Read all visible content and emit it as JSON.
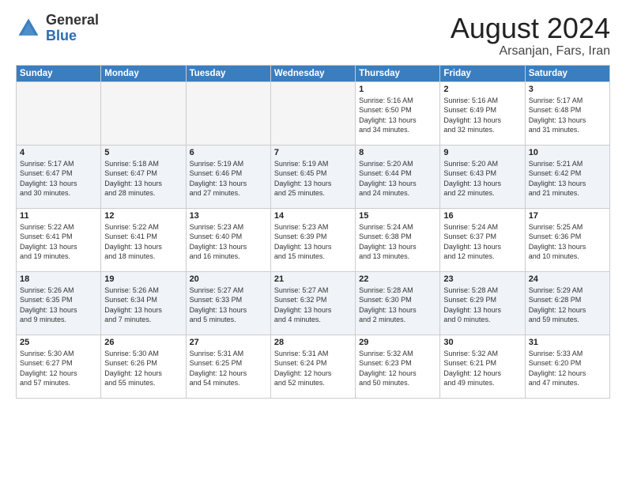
{
  "header": {
    "logo_general": "General",
    "logo_blue": "Blue",
    "month_title": "August 2024",
    "location": "Arsanjan, Fars, Iran"
  },
  "days_of_week": [
    "Sunday",
    "Monday",
    "Tuesday",
    "Wednesday",
    "Thursday",
    "Friday",
    "Saturday"
  ],
  "weeks": [
    [
      {
        "day": "",
        "info": ""
      },
      {
        "day": "",
        "info": ""
      },
      {
        "day": "",
        "info": ""
      },
      {
        "day": "",
        "info": ""
      },
      {
        "day": "1",
        "info": "Sunrise: 5:16 AM\nSunset: 6:50 PM\nDaylight: 13 hours\nand 34 minutes."
      },
      {
        "day": "2",
        "info": "Sunrise: 5:16 AM\nSunset: 6:49 PM\nDaylight: 13 hours\nand 32 minutes."
      },
      {
        "day": "3",
        "info": "Sunrise: 5:17 AM\nSunset: 6:48 PM\nDaylight: 13 hours\nand 31 minutes."
      }
    ],
    [
      {
        "day": "4",
        "info": "Sunrise: 5:17 AM\nSunset: 6:47 PM\nDaylight: 13 hours\nand 30 minutes."
      },
      {
        "day": "5",
        "info": "Sunrise: 5:18 AM\nSunset: 6:47 PM\nDaylight: 13 hours\nand 28 minutes."
      },
      {
        "day": "6",
        "info": "Sunrise: 5:19 AM\nSunset: 6:46 PM\nDaylight: 13 hours\nand 27 minutes."
      },
      {
        "day": "7",
        "info": "Sunrise: 5:19 AM\nSunset: 6:45 PM\nDaylight: 13 hours\nand 25 minutes."
      },
      {
        "day": "8",
        "info": "Sunrise: 5:20 AM\nSunset: 6:44 PM\nDaylight: 13 hours\nand 24 minutes."
      },
      {
        "day": "9",
        "info": "Sunrise: 5:20 AM\nSunset: 6:43 PM\nDaylight: 13 hours\nand 22 minutes."
      },
      {
        "day": "10",
        "info": "Sunrise: 5:21 AM\nSunset: 6:42 PM\nDaylight: 13 hours\nand 21 minutes."
      }
    ],
    [
      {
        "day": "11",
        "info": "Sunrise: 5:22 AM\nSunset: 6:41 PM\nDaylight: 13 hours\nand 19 minutes."
      },
      {
        "day": "12",
        "info": "Sunrise: 5:22 AM\nSunset: 6:41 PM\nDaylight: 13 hours\nand 18 minutes."
      },
      {
        "day": "13",
        "info": "Sunrise: 5:23 AM\nSunset: 6:40 PM\nDaylight: 13 hours\nand 16 minutes."
      },
      {
        "day": "14",
        "info": "Sunrise: 5:23 AM\nSunset: 6:39 PM\nDaylight: 13 hours\nand 15 minutes."
      },
      {
        "day": "15",
        "info": "Sunrise: 5:24 AM\nSunset: 6:38 PM\nDaylight: 13 hours\nand 13 minutes."
      },
      {
        "day": "16",
        "info": "Sunrise: 5:24 AM\nSunset: 6:37 PM\nDaylight: 13 hours\nand 12 minutes."
      },
      {
        "day": "17",
        "info": "Sunrise: 5:25 AM\nSunset: 6:36 PM\nDaylight: 13 hours\nand 10 minutes."
      }
    ],
    [
      {
        "day": "18",
        "info": "Sunrise: 5:26 AM\nSunset: 6:35 PM\nDaylight: 13 hours\nand 9 minutes."
      },
      {
        "day": "19",
        "info": "Sunrise: 5:26 AM\nSunset: 6:34 PM\nDaylight: 13 hours\nand 7 minutes."
      },
      {
        "day": "20",
        "info": "Sunrise: 5:27 AM\nSunset: 6:33 PM\nDaylight: 13 hours\nand 5 minutes."
      },
      {
        "day": "21",
        "info": "Sunrise: 5:27 AM\nSunset: 6:32 PM\nDaylight: 13 hours\nand 4 minutes."
      },
      {
        "day": "22",
        "info": "Sunrise: 5:28 AM\nSunset: 6:30 PM\nDaylight: 13 hours\nand 2 minutes."
      },
      {
        "day": "23",
        "info": "Sunrise: 5:28 AM\nSunset: 6:29 PM\nDaylight: 13 hours\nand 0 minutes."
      },
      {
        "day": "24",
        "info": "Sunrise: 5:29 AM\nSunset: 6:28 PM\nDaylight: 12 hours\nand 59 minutes."
      }
    ],
    [
      {
        "day": "25",
        "info": "Sunrise: 5:30 AM\nSunset: 6:27 PM\nDaylight: 12 hours\nand 57 minutes."
      },
      {
        "day": "26",
        "info": "Sunrise: 5:30 AM\nSunset: 6:26 PM\nDaylight: 12 hours\nand 55 minutes."
      },
      {
        "day": "27",
        "info": "Sunrise: 5:31 AM\nSunset: 6:25 PM\nDaylight: 12 hours\nand 54 minutes."
      },
      {
        "day": "28",
        "info": "Sunrise: 5:31 AM\nSunset: 6:24 PM\nDaylight: 12 hours\nand 52 minutes."
      },
      {
        "day": "29",
        "info": "Sunrise: 5:32 AM\nSunset: 6:23 PM\nDaylight: 12 hours\nand 50 minutes."
      },
      {
        "day": "30",
        "info": "Sunrise: 5:32 AM\nSunset: 6:21 PM\nDaylight: 12 hours\nand 49 minutes."
      },
      {
        "day": "31",
        "info": "Sunrise: 5:33 AM\nSunset: 6:20 PM\nDaylight: 12 hours\nand 47 minutes."
      }
    ]
  ]
}
